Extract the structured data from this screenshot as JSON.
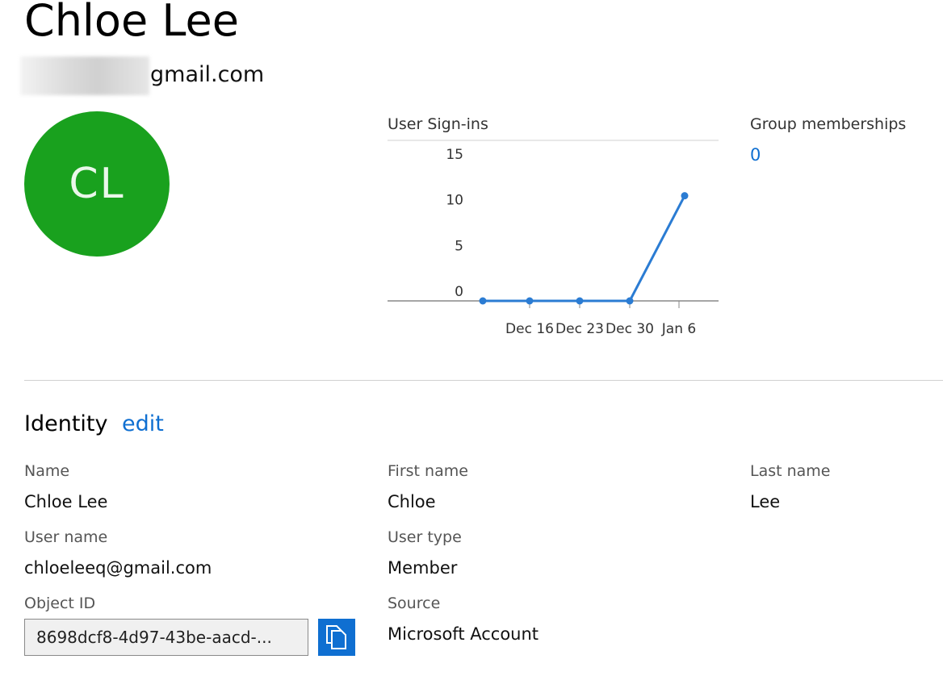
{
  "user": {
    "display_name": "Chloe Lee",
    "email_visible": "gmail.com",
    "avatar_initials": "CL",
    "avatar_color": "#19a11e"
  },
  "signins": {
    "title": "User Sign-ins"
  },
  "groups": {
    "title": "Group memberships",
    "count": "0"
  },
  "identity": {
    "title": "Identity",
    "edit_label": "edit",
    "fields": {
      "name": {
        "label": "Name",
        "value": "Chloe Lee"
      },
      "first_name": {
        "label": "First name",
        "value": "Chloe"
      },
      "last_name": {
        "label": "Last name",
        "value": "Lee"
      },
      "user_name": {
        "label": "User name",
        "value": "chloeleeq@gmail.com"
      },
      "user_type": {
        "label": "User type",
        "value": "Member"
      },
      "object_id": {
        "label": "Object ID",
        "value": "8698dcf8-4d97-43be-aacd-..."
      },
      "source": {
        "label": "Source",
        "value": "Microsoft Account"
      }
    }
  },
  "colors": {
    "accent": "#0f6fd1",
    "line": "#2b7cd3",
    "copy_button": "#0f6fd1"
  },
  "icons": {
    "copy": "copy-icon"
  },
  "chart_data": {
    "type": "line",
    "title": "User Sign-ins",
    "x_ticks": [
      "Dec 16",
      "Dec 23",
      "Dec 30",
      "Jan 6"
    ],
    "y_ticks": [
      0,
      5,
      10,
      15
    ],
    "ylim": [
      0,
      17
    ],
    "series": [
      {
        "x": [
          "Dec 9",
          "Dec 16",
          "Dec 23",
          "Dec 30",
          "Jan 8"
        ],
        "values": [
          0,
          0,
          0,
          0,
          11.5
        ]
      }
    ],
    "grid": false
  }
}
